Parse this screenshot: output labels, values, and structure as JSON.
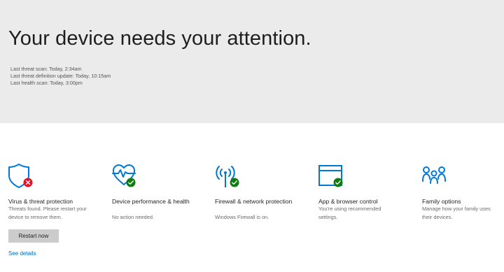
{
  "header": {
    "title": "Your device needs your attention.",
    "scan_info": [
      "Last threat scan: Today, 2:34am",
      "Last threat definition update: Today, 10:15am",
      "Last health scan: Today, 3:00pm"
    ]
  },
  "colors": {
    "accent": "#0078d7",
    "ok": "#107c10",
    "error": "#e81123",
    "hero_background": "#ebebeb",
    "link": "#0067b8"
  },
  "tiles": [
    {
      "icon": "shield-icon",
      "status_icon": "error-badge-icon",
      "title": "Virus & threat protection",
      "description": "Threats found. Please restart your device to remove them."
    },
    {
      "icon": "heart-pulse-icon",
      "status_icon": "check-badge-icon",
      "title": "Device performance & health",
      "description": "No action needed."
    },
    {
      "icon": "wireless-antenna-icon",
      "status_icon": "check-badge-icon",
      "title": "Firewall & network protection",
      "description": "Windows Firewall is on."
    },
    {
      "icon": "browser-window-icon",
      "status_icon": "check-badge-icon",
      "title": "App & browser control",
      "description": "You're using recommended settings."
    },
    {
      "icon": "family-icon",
      "status_icon": "",
      "title": "Family options",
      "description": "Manage how your family uses their devices."
    }
  ],
  "actions": {
    "restart_label": "Restart now",
    "see_details_label": "See details"
  }
}
